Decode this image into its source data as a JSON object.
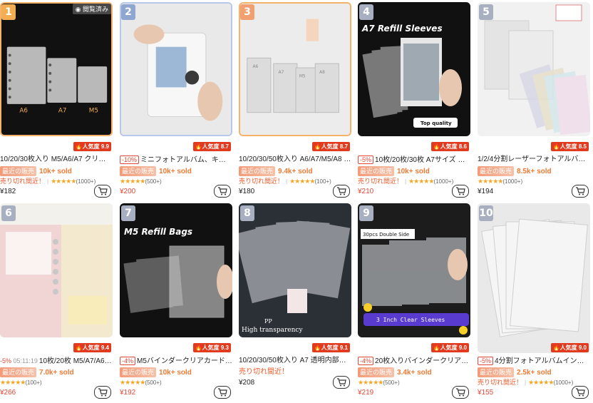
{
  "products": [
    {
      "rank": "1",
      "badge": "閲覧済み",
      "popularity": "人気度 9.9",
      "discount": "",
      "title": "10/20/30枚入り M5/A6/A7 クリアルー...",
      "sales_tag": "最近の販売",
      "sold": "10k+ sold",
      "soon": "売り切れ間近！",
      "stars": "★★★★★",
      "reviews": "(1000+)",
      "price": "¥182",
      "img_labels": [
        "A6",
        "A7",
        "M5"
      ]
    },
    {
      "rank": "2",
      "badge": "",
      "popularity": "人気度 8.7",
      "discount": "-10%",
      "title": "ミニフォトアルバム、キーホル...",
      "sales_tag": "最近の販売",
      "sold": "10k+ sold",
      "soon": "",
      "stars": "★★★★★",
      "reviews": "(500+)",
      "price": "¥200"
    },
    {
      "rank": "3",
      "badge": "",
      "popularity": "人気度 8.7",
      "discount": "",
      "title": "10/20/30/50枚入り A6/A7/M5/A8 透明...",
      "sales_tag": "最近の販売",
      "sold": "9.4k+ sold",
      "soon": "売り切れ間近！",
      "stars": "★★★★★",
      "reviews": "(100+)",
      "price": "¥180",
      "img_labels": [
        "A6",
        "A7",
        "M5",
        "A8"
      ]
    },
    {
      "rank": "4",
      "badge": "",
      "popularity": "人気度 8.6",
      "discount": "-5%",
      "title": "10枚/20枚/30枚 A7サイズ クリ...",
      "sales_tag": "最近の販売",
      "sold": "10k+ sold",
      "soon": "売り切れ間近！",
      "stars": "★★★★★",
      "reviews": "(1000+)",
      "price": "¥210",
      "img_labels": [
        "A7 Refill Sleeves",
        "Top quality"
      ]
    },
    {
      "rank": "5",
      "badge": "",
      "popularity": "人気度 8.5",
      "discount": "",
      "title": "1/2/4分割レーザーフォトアルバム フ...",
      "sales_tag": "最近の販売",
      "sold": "8.5k+ sold",
      "soon": "",
      "stars": "★★★★★",
      "reviews": "(1000+)",
      "price": "¥194"
    },
    {
      "rank": "6",
      "badge": "",
      "popularity": "人気度 9.4",
      "discount": "-5%",
      "discount_extra": "05:11:19",
      "title": "10枚/20枚 M5/A7/A6 リ...",
      "sales_tag": "最近の販売",
      "sold": "7.0k+ sold",
      "soon": "",
      "stars": "★★★★★",
      "reviews": "(100+)",
      "price": "¥266"
    },
    {
      "rank": "7",
      "badge": "",
      "popularity": "人気度 9.3",
      "discount": "-4%",
      "title": "M5バインダークリアカードスリ...",
      "sales_tag": "最近の販売",
      "sold": "10k+ sold",
      "soon": "",
      "stars": "★★★★★",
      "reviews": "(500+)",
      "price": "¥192",
      "img_labels": [
        "M5 Refill Bags"
      ]
    },
    {
      "rank": "8",
      "badge": "",
      "popularity": "人気度 9.1",
      "discount": "",
      "title": "10/20/30/50枚入り A7 透明内部ペー...",
      "sales_tag": "",
      "sold": "",
      "soon": "売り切れ間近！",
      "stars": "",
      "reviews": "",
      "price": "¥208",
      "img_labels": [
        "PP",
        "High transparency"
      ]
    },
    {
      "rank": "9",
      "badge": "",
      "popularity": "人気度 9.0",
      "discount": "-4%",
      "title": "20枚入りバインダークリアカー...",
      "sales_tag": "最近の販売",
      "sold": "3.4k+ sold",
      "soon": "",
      "stars": "★★★★★",
      "reviews": "(500+)",
      "price": "¥219",
      "img_labels": [
        "30pcs Double Side",
        "3 Inch Clear Sleeves"
      ]
    },
    {
      "rank": "10",
      "badge": "",
      "popularity": "人気度 9.0",
      "discount": "-5%",
      "title": "4分割フォトアルバムインナーペ...",
      "sales_tag": "最近の販売",
      "sold": "2.5k+ sold",
      "soon": "売り切れ間近！",
      "stars": "★★★★★",
      "reviews": "(1000+)",
      "price": "¥155"
    }
  ],
  "colors": {
    "accent_red": "#e2483a",
    "sold_orange": "#f07a33",
    "star": "#f5a623",
    "rank_gold": "#f3ae53",
    "rank_blue": "#8fa6d1"
  },
  "icons": {
    "cart": "add-to-cart-icon",
    "flame": "flame-icon",
    "eye": "eye-icon"
  }
}
